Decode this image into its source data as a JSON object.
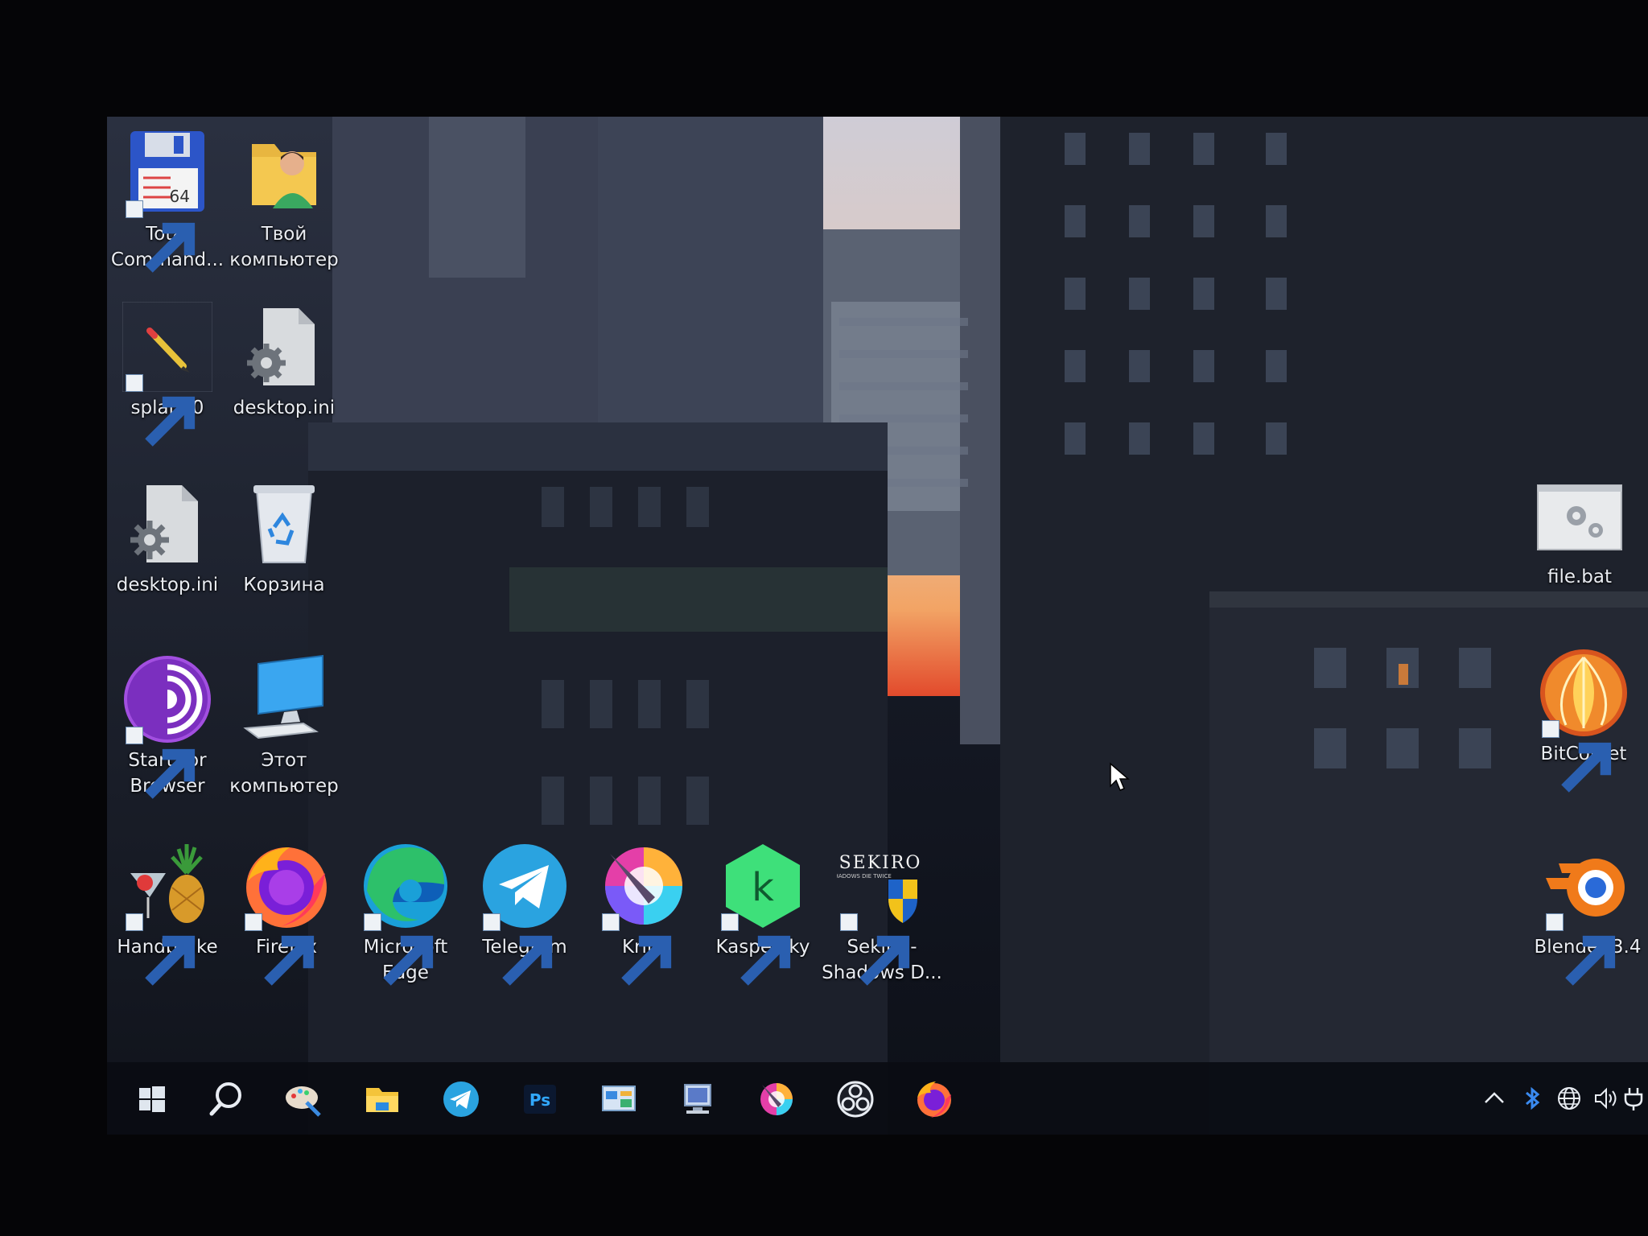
{
  "desktop": {
    "icons": [
      {
        "id": "total-commander",
        "label": "Total\nCommand...",
        "badge": "64"
      },
      {
        "id": "tvoy-kompyuter",
        "label": "Твой\nкомпьютер"
      },
      {
        "id": "splan70",
        "label": "splan70"
      },
      {
        "id": "desktop-ini-1",
        "label": "desktop.ini"
      },
      {
        "id": "desktop-ini-2",
        "label": "desktop.ini"
      },
      {
        "id": "korzina",
        "label": "Корзина"
      },
      {
        "id": "file-bat",
        "label": "file.bat"
      },
      {
        "id": "start-tor-browser",
        "label": "Start Tor\nBrowser"
      },
      {
        "id": "etot-kompyuter",
        "label": "Этот\nкомпьютер"
      },
      {
        "id": "bitcomet",
        "label": "BitComet"
      },
      {
        "id": "handbrake",
        "label": "Handbrake"
      },
      {
        "id": "firefox",
        "label": "Firefox"
      },
      {
        "id": "microsoft-edge",
        "label": "Microsoft\nEdge"
      },
      {
        "id": "telegram",
        "label": "Telegram"
      },
      {
        "id": "krita",
        "label": "Krita"
      },
      {
        "id": "kaspersky",
        "label": "Kaspersky",
        "glyph": "k"
      },
      {
        "id": "sekiro",
        "label": "Sekiro -\nShadows D...",
        "logo": "SEKIRO",
        "logo_sub": "SHADOWS DIE TWICE"
      },
      {
        "id": "blender",
        "label": "Blender 3.4"
      }
    ]
  },
  "taskbar": {
    "items": [
      {
        "id": "start",
        "icon": "windows-logo-icon"
      },
      {
        "id": "search",
        "icon": "search-icon"
      },
      {
        "id": "paint",
        "icon": "paint-icon"
      },
      {
        "id": "file-explorer",
        "icon": "folder-icon"
      },
      {
        "id": "telegram",
        "icon": "telegram-icon"
      },
      {
        "id": "photoshop",
        "icon": "photoshop-icon",
        "text": "Ps"
      },
      {
        "id": "control-panel",
        "icon": "control-panel-icon"
      },
      {
        "id": "this-pc",
        "icon": "computer-icon"
      },
      {
        "id": "krita",
        "icon": "krita-icon"
      },
      {
        "id": "obs",
        "icon": "obs-icon"
      },
      {
        "id": "firefox",
        "icon": "firefox-icon"
      }
    ],
    "tray": [
      {
        "id": "show-hidden",
        "icon": "chevron-up-icon"
      },
      {
        "id": "bluetooth",
        "icon": "bluetooth-icon"
      },
      {
        "id": "network",
        "icon": "globe-icon"
      },
      {
        "id": "volume",
        "icon": "speaker-icon"
      },
      {
        "id": "power",
        "icon": "plug-icon"
      }
    ]
  },
  "colors": {
    "label": "#e9ecf2",
    "taskbar": "#0a0c12",
    "sky_top": "#c9c7d2",
    "sunset": "#f0a060"
  }
}
